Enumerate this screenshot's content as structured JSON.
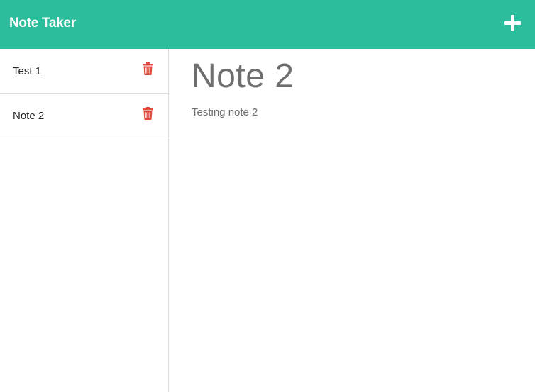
{
  "app": {
    "title": "Note Taker"
  },
  "colors": {
    "accent": "#2bbd9c",
    "delete": "#e04b3e",
    "text_muted": "#6e6e6e"
  },
  "header": {
    "add_icon": "plus-icon"
  },
  "notes": [
    {
      "title": "Test 1",
      "delete_icon": "trash-icon"
    },
    {
      "title": "Note 2",
      "delete_icon": "trash-icon"
    }
  ],
  "active_note": {
    "title": "Note 2",
    "body": "Testing note 2"
  }
}
